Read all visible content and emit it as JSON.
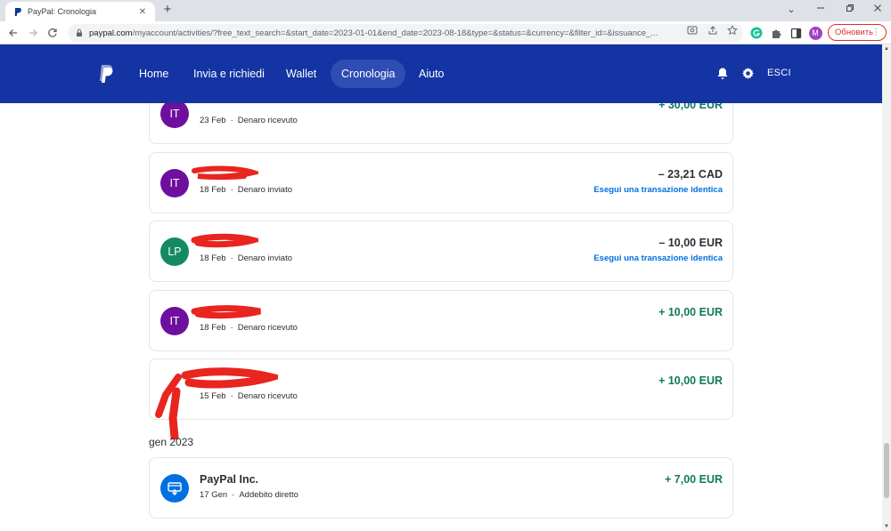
{
  "browser": {
    "tab_title": "PayPal: Cronologia",
    "tab_close": "✕",
    "new_tab": "+",
    "url_host": "paypal.com",
    "url_path": "/myaccount/activities/?free_text_search=&start_date=2023-01-01&end_date=2023-08-18&type=&status=&currency=&filter_id=&issuance_...",
    "profile_initial": "M",
    "update_label": "Обновить",
    "menu_glyph": "⋮",
    "minimize": "⌄",
    "colors": {
      "tab_strip": "#dee1e6",
      "update_red": "#d93025",
      "profile": "#a142c4"
    }
  },
  "header": {
    "nav": [
      {
        "label": "Home",
        "active": false
      },
      {
        "label": "Invia e richiedi",
        "active": false
      },
      {
        "label": "Wallet",
        "active": false
      },
      {
        "label": "Cronologia",
        "active": true
      },
      {
        "label": "Aiuto",
        "active": false
      }
    ],
    "logout_label": "ESCI",
    "icons": [
      "paypal-logo",
      "bell-icon",
      "gear-icon"
    ],
    "colors": {
      "background": "#1434a4",
      "active_pill": "#2f4db3"
    }
  },
  "activity": {
    "separator": "·",
    "repeat_label": "Esegui una transazione identica",
    "transactions": [
      {
        "initials": "IT",
        "name": "",
        "date": "23 Feb",
        "type": "Denaro ricevuto",
        "amount": "+ 30,00 EUR",
        "direction": "in",
        "avatar_color": "#6e0f9e"
      },
      {
        "initials": "IT",
        "name": "",
        "date": "18 Feb",
        "type": "Denaro inviato",
        "amount": "– 23,21 CAD",
        "direction": "out",
        "avatar_color": "#6e0f9e"
      },
      {
        "initials": "LP",
        "name": "",
        "date": "18 Feb",
        "type": "Denaro inviato",
        "amount": "– 10,00 EUR",
        "direction": "out",
        "avatar_color": "#138a63"
      },
      {
        "initials": "IT",
        "name": "",
        "date": "18 Feb",
        "type": "Denaro ricevuto",
        "amount": "+ 10,00 EUR",
        "direction": "in",
        "avatar_color": "#6e0f9e"
      },
      {
        "initials": "",
        "name": "",
        "date": "15 Feb",
        "type": "Denaro ricevuto",
        "amount": "+ 10,00 EUR",
        "direction": "in",
        "avatar_color": ""
      }
    ],
    "month_label": "gen 2023",
    "january": [
      {
        "icon": "bank-transfer-icon",
        "name": "PayPal Inc.",
        "date": "17 Gen",
        "type": "Addebito diretto",
        "amount": "+ 7,00 EUR",
        "direction": "in",
        "avatar_color": "#0070e0"
      }
    ],
    "colors": {
      "positive": "#107a5a",
      "negative": "#2c2e2f",
      "link": "#0070e0",
      "redaction": "#e8251f"
    }
  }
}
